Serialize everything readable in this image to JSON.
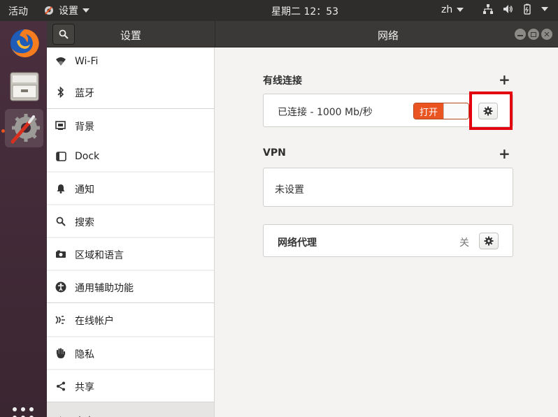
{
  "topbar": {
    "activities": "活动",
    "app_name": "设置",
    "clock": "星期二 12：53",
    "lang": "zh"
  },
  "headerbar": {
    "left_title": "设置",
    "title": "网络"
  },
  "sidebar": {
    "items": [
      {
        "label": "Wi-Fi",
        "icon": "wifi-icon"
      },
      {
        "label": "蓝牙",
        "icon": "bluetooth-icon"
      },
      {
        "label": "背景",
        "icon": "background-icon"
      },
      {
        "label": "Dock",
        "icon": "dock-icon"
      },
      {
        "label": "通知",
        "icon": "bell-icon"
      },
      {
        "label": "搜索",
        "icon": "search-icon"
      },
      {
        "label": "区域和语言",
        "icon": "camera-icon"
      },
      {
        "label": "通用辅助功能",
        "icon": "accessibility-icon"
      },
      {
        "label": "在线帐户",
        "icon": "online-accounts-icon"
      },
      {
        "label": "隐私",
        "icon": "hand-icon"
      },
      {
        "label": "共享",
        "icon": "share-icon"
      },
      {
        "label": "声音",
        "icon": "speaker-icon"
      }
    ]
  },
  "main": {
    "wired": {
      "title": "有线连接",
      "status": "已连接 - 1000 Mb/秒",
      "toggle_label": "打开"
    },
    "vpn": {
      "title": "VPN",
      "status": "未设置"
    },
    "proxy": {
      "title": "网络代理",
      "status": "关"
    }
  },
  "colors": {
    "accent": "#e95420",
    "highlight": "#e3000f",
    "topbar": "#2f2d2b",
    "dock": "#3d2a34"
  }
}
